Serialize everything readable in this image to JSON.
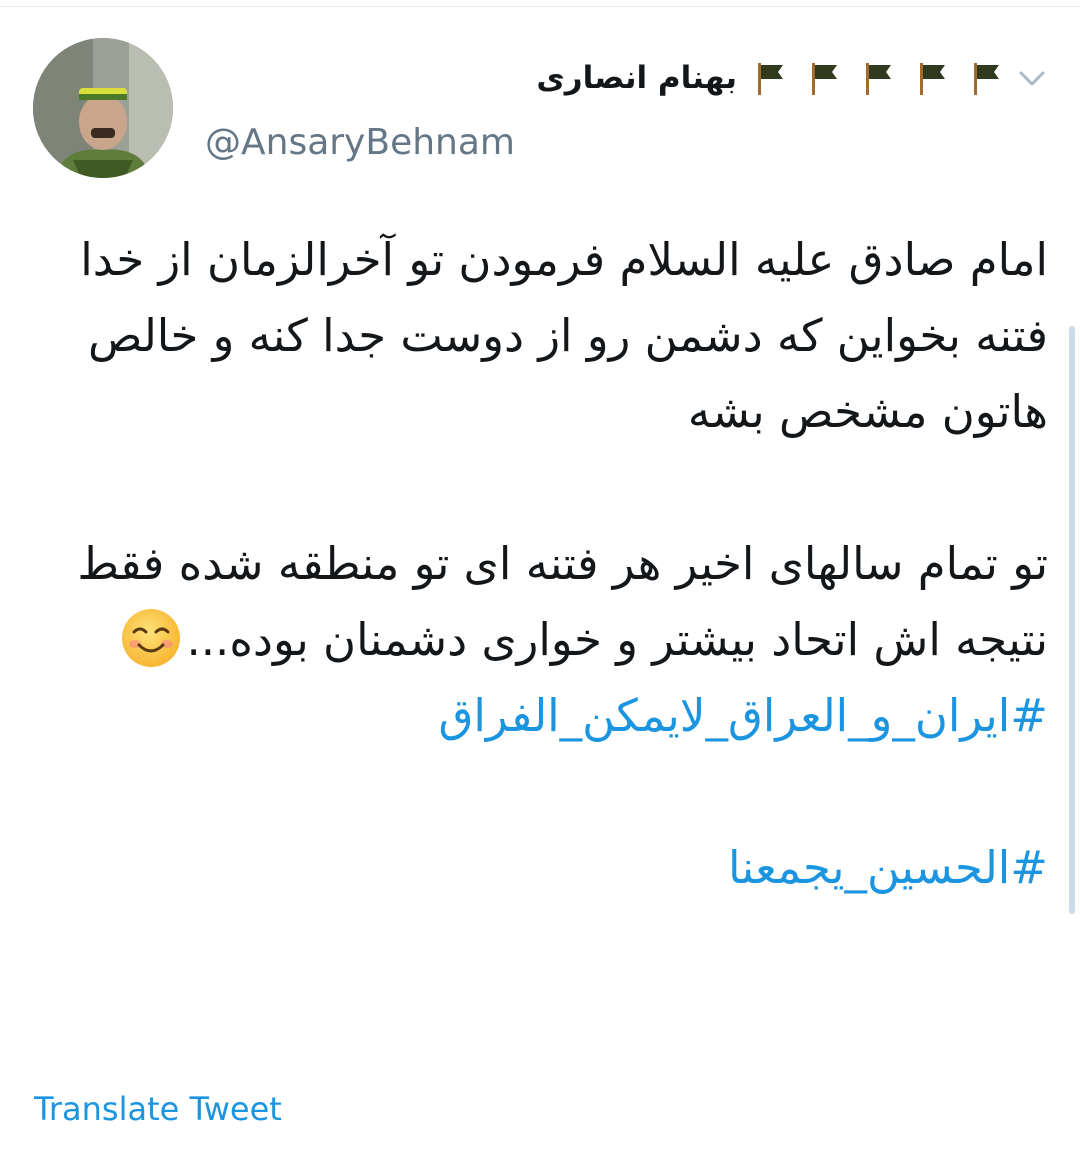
{
  "tweet": {
    "author": {
      "display_name": "بهنام انصاری",
      "handle": "@AnsaryBehnam",
      "flag_emojis": [
        "🏴",
        "🏴",
        "🏴",
        "🏴",
        "🏴"
      ],
      "avatar_icon": "user-avatar-photo"
    },
    "menu_icon": "chevron-down-icon",
    "lines": {
      "p1": "امام صادق علیه السلام فرمودن تو آخرالزمان از خدا فتنه بخواین که دشمن رو از دوست جدا کنه و خالص هاتون مشخص بشه",
      "p2": "تو تمام سالهای اخیر هر فتنه ای تو منطقه شده فقط نتیجه اش اتحاد بیشتر و خواری دشمنان بوده...",
      "emoji": "😊",
      "hashtag1": "#ایران_و_العراق_لایمکن_الفراق",
      "hashtag2": "#الحسین_یجمعنا"
    },
    "translate_label": "Translate Tweet"
  },
  "colors": {
    "text": "#14171a",
    "secondary": "#657786",
    "link": "#1b95e0",
    "flag": "#2f3a1e"
  }
}
